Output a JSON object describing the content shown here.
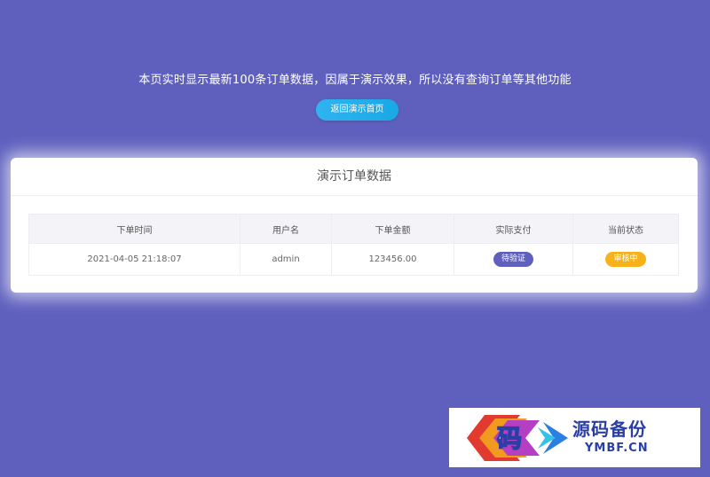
{
  "notice": "本页实时显示最新100条订单数据，因属于演示效果，所以没有查询订单等其他功能",
  "back_button": "返回演示首页",
  "card": {
    "title": "演示订单数据",
    "columns": [
      "下单时间",
      "用户名",
      "下单金额",
      "实际支付",
      "当前状态"
    ],
    "rows": [
      {
        "time": "2021-04-05 21:18:07",
        "user": "admin",
        "amount": "123456.00",
        "payment": "待验证",
        "status": "审核中"
      }
    ]
  },
  "watermark": {
    "logo_char": "码",
    "cn": "源码备份",
    "en": "YMBF.CN"
  },
  "colors": {
    "background": "#5f60be",
    "button": "#18a9e6",
    "payment_badge": "#5f60be",
    "status_badge": "#f7b21a"
  }
}
